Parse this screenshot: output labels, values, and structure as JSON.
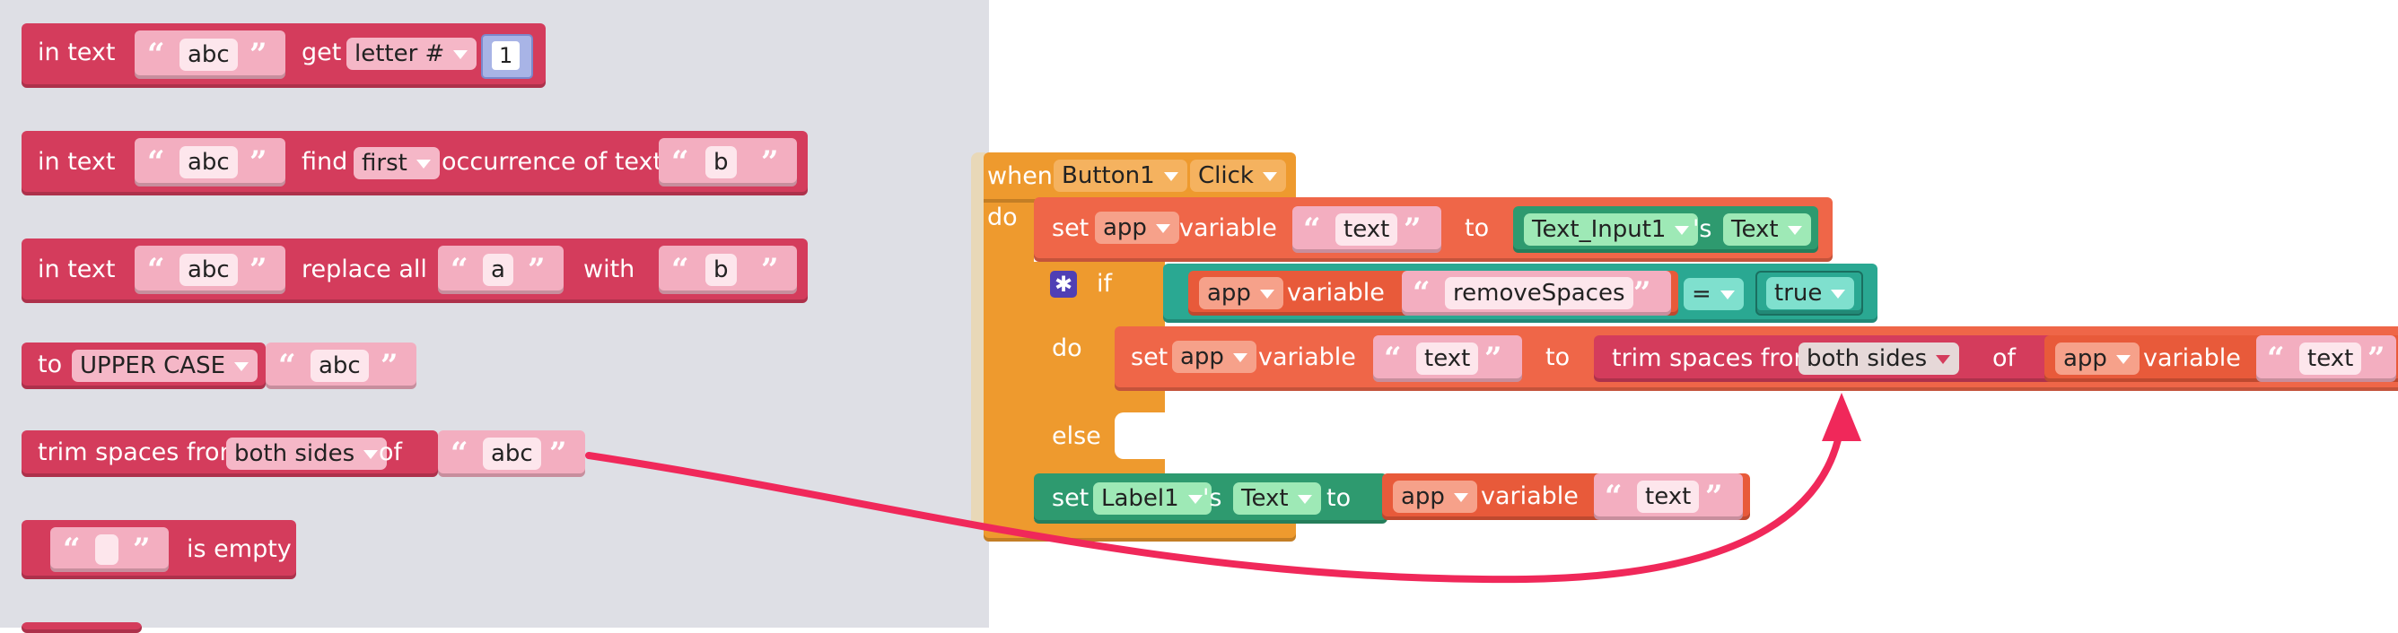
{
  "flyout": {
    "block1": {
      "in_text": "in text",
      "value": "abc",
      "get": "get",
      "letter_dd": "letter #",
      "index": "1"
    },
    "block2": {
      "in_text": "in text",
      "value": "abc",
      "find": "find",
      "first_dd": "first",
      "occ": "occurrence of text",
      "search": "b"
    },
    "block3": {
      "in_text": "in text",
      "value": "abc",
      "replace": "replace all",
      "from": "a",
      "with": "with",
      "to": "b"
    },
    "block4": {
      "to": "to",
      "case_dd": "UPPER CASE",
      "value": "abc"
    },
    "block5": {
      "trim": "trim spaces from",
      "sides_dd": "both sides",
      "of": "of",
      "value": "abc"
    },
    "block6": {
      "value": "",
      "is_empty": "is empty"
    }
  },
  "workspace": {
    "event": {
      "when": "when",
      "component_dd": "Button1",
      "event_dd": "Click",
      "do": "do"
    },
    "set1": {
      "set": "set",
      "scope_dd": "app",
      "variable": "variable",
      "name": "text",
      "to": "to",
      "comp_dd": "Text_Input1",
      "poss": "'s",
      "prop_dd": "Text"
    },
    "if": {
      "if": "if",
      "scope_dd": "app",
      "variable": "variable",
      "name": "removeSpaces",
      "op_dd": "=",
      "value_dd": "true",
      "do": "do",
      "else": "else"
    },
    "set2": {
      "set": "set",
      "scope_dd": "app",
      "variable": "variable",
      "name": "text",
      "to": "to",
      "trim": "trim spaces from",
      "sides_dd": "both sides",
      "of": "of",
      "scope2_dd": "app",
      "variable2": "variable",
      "name2": "text"
    },
    "set3": {
      "set": "set",
      "comp_dd": "Label1",
      "poss": "'s",
      "prop_dd": "Text",
      "to": "to",
      "scope_dd": "app",
      "variable": "variable",
      "name": "text"
    }
  },
  "colors": {
    "text_block": "#d43c5c",
    "text_literal": "#f3aec0",
    "event": "#ee9a2e",
    "variable": "#ef6648",
    "component": "#2e9a6f",
    "logic": "#2aa892",
    "arrow": "#f0285a"
  }
}
